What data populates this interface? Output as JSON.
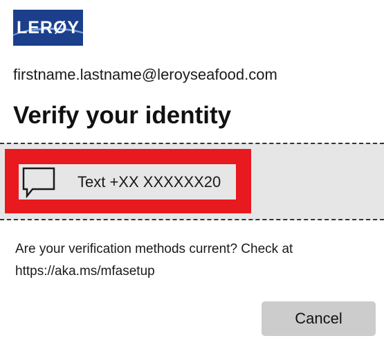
{
  "logo": {
    "text": "LERØY"
  },
  "account": {
    "email": "firstname.lastname@leroyseafood.com"
  },
  "title": "Verify your identity",
  "methods": [
    {
      "icon": "sms-chat-bubble-icon",
      "label": "Text +XX XXXXXX20"
    }
  ],
  "note": {
    "line1": "Are your verification methods current? Check at",
    "line2": "https://aka.ms/mfasetup"
  },
  "buttons": {
    "cancel_label": "Cancel"
  },
  "colors": {
    "logo_bg": "#1c3f8c",
    "highlight": "#e8191f",
    "panel_bg": "#e6e6e6",
    "button_bg": "#cccccc"
  }
}
